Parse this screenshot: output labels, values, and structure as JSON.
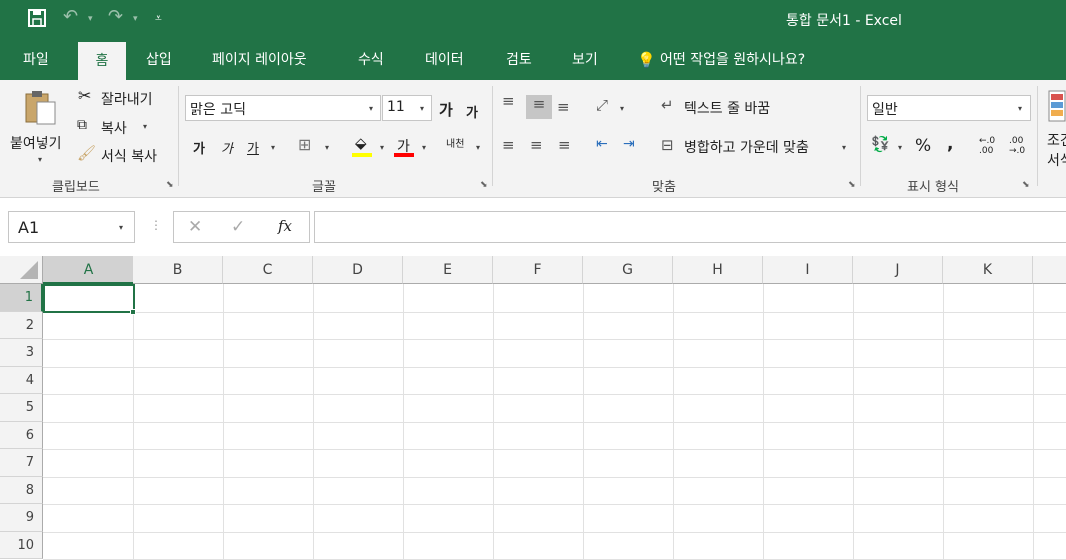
{
  "title": "통합 문서1  -  Excel",
  "qat": {
    "save": "💾",
    "undo": "↶",
    "redo": "↷",
    "customize": "⩡"
  },
  "tabs": [
    {
      "label": "파일"
    },
    {
      "label": "홈"
    },
    {
      "label": "삽입"
    },
    {
      "label": "페이지 레이아웃"
    },
    {
      "label": "수식"
    },
    {
      "label": "데이터"
    },
    {
      "label": "검토"
    },
    {
      "label": "보기"
    }
  ],
  "tellme": "어떤 작업을 원하시나요?",
  "clipboard": {
    "paste": "붙여넣기",
    "cut": "잘라내기",
    "copy": "복사",
    "format_painter": "서식 복사",
    "label": "클립보드"
  },
  "font": {
    "name": "맑은 고딕",
    "size": "11",
    "grow": "가",
    "shrink": "가",
    "bold": "가",
    "italic": "가",
    "underline": "가",
    "color_letter": "가",
    "phonetic": "내천",
    "label": "글꼴"
  },
  "alignment": {
    "wrap": "텍스트 줄 바꿈",
    "merge": "병합하고 가운데 맞춤",
    "label": "맞춤"
  },
  "number": {
    "format": "일반",
    "percent": "%",
    "comma": ",",
    "inc": "←.0\n.00",
    "dec": ".00\n→.0",
    "label": "표시 형식"
  },
  "styles": {
    "cond": "조건",
    "sub": "서식"
  },
  "namebox": "A1",
  "fx": "fx",
  "columns": [
    "A",
    "B",
    "C",
    "D",
    "E",
    "F",
    "G",
    "H",
    "I",
    "J",
    "K"
  ],
  "rows": [
    "1",
    "2",
    "3",
    "4",
    "5",
    "6",
    "7",
    "8",
    "9",
    "10"
  ],
  "colors": {
    "accent": "#217346",
    "highlight": "#ffff00",
    "fontcolor": "#ff0000"
  }
}
